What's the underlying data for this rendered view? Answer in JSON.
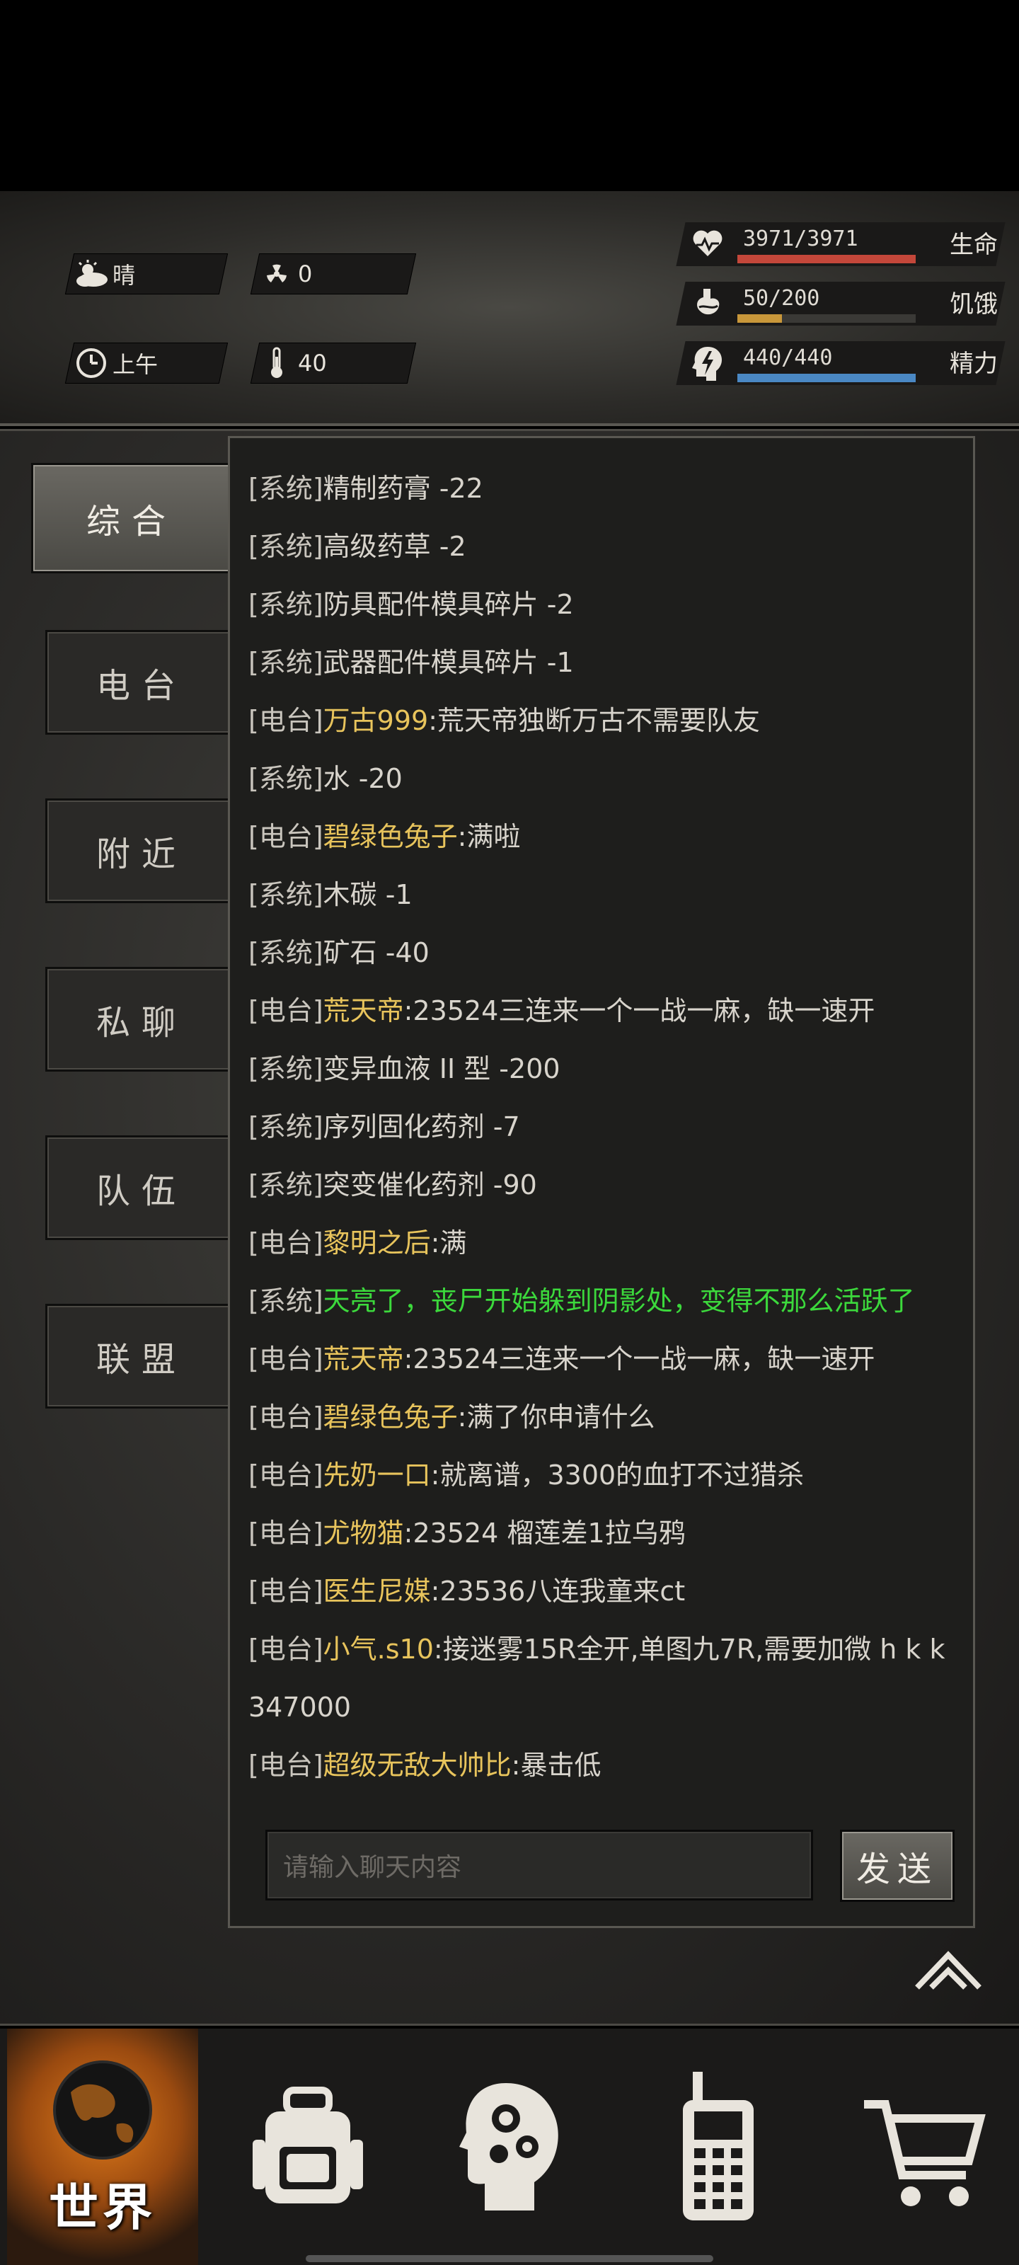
{
  "status": {
    "weather_label": "晴",
    "radiation_value": "0",
    "time_of_day": "上午",
    "temperature_value": "40",
    "vitals": [
      {
        "label": "生命",
        "value": "3971/3971",
        "fill": 1.0,
        "color": "#c4473a",
        "icon": "heart-pulse-icon"
      },
      {
        "label": "饥饿",
        "value": "50/200",
        "fill": 0.25,
        "color": "#c8973a",
        "icon": "stomach-icon"
      },
      {
        "label": "精力",
        "value": "440/440",
        "fill": 1.0,
        "color": "#4a88c4",
        "icon": "head-energy-icon"
      }
    ]
  },
  "tabs": [
    "综合",
    "电台",
    "附近",
    "私聊",
    "队伍",
    "联盟"
  ],
  "active_tab": 0,
  "messages": [
    {
      "tag": "[系统]",
      "nick": "",
      "text": "精制药膏 -22"
    },
    {
      "tag": "[系统]",
      "nick": "",
      "text": "高级药草 -2"
    },
    {
      "tag": "[系统]",
      "nick": "",
      "text": "防具配件模具碎片 -2"
    },
    {
      "tag": "[系统]",
      "nick": "",
      "text": "武器配件模具碎片 -1"
    },
    {
      "tag": "[电台]",
      "nick": "万古999",
      "text": ":荒天帝独断万古不需要队友"
    },
    {
      "tag": "[系统]",
      "nick": "",
      "text": "水 -20"
    },
    {
      "tag": "[电台]",
      "nick": "碧绿色兔子",
      "text": ":满啦"
    },
    {
      "tag": "[系统]",
      "nick": "",
      "text": "木碳 -1"
    },
    {
      "tag": "[系统]",
      "nick": "",
      "text": "矿石 -40"
    },
    {
      "tag": "[电台]",
      "nick": "荒天帝",
      "text": ":23524三连来一个一战一麻，缺一速开"
    },
    {
      "tag": "[系统]",
      "nick": "",
      "text": "变异血液 II 型 -200"
    },
    {
      "tag": "[系统]",
      "nick": "",
      "text": "序列固化药剂 -7"
    },
    {
      "tag": "[系统]",
      "nick": "",
      "text": "突变催化药剂 -90"
    },
    {
      "tag": "[电台]",
      "nick": "黎明之后",
      "text": ":满"
    },
    {
      "tag": "[系统]",
      "nick": "",
      "text": "天亮了，丧尸开始躲到阴影处，变得不那么活跃了",
      "green": true
    },
    {
      "tag": "[电台]",
      "nick": "荒天帝",
      "text": ":23524三连来一个一战一麻，缺一速开"
    },
    {
      "tag": "[电台]",
      "nick": "碧绿色兔子",
      "text": ":满了你申请什么"
    },
    {
      "tag": "[电台]",
      "nick": "先奶一口",
      "text": ":就离谱，3300的血打不过猎杀"
    },
    {
      "tag": "[电台]",
      "nick": "尤物猫",
      "text": ":23524 榴莲差1拉乌鸦"
    },
    {
      "tag": "[电台]",
      "nick": "医生尼媒",
      "text": ":23536八连我童来ct"
    },
    {
      "tag": "[电台]",
      "nick": "小气.s10",
      "text": ":接迷雾15R全开,单图九7R,需要加微 h k k 347000",
      "wrap": true
    },
    {
      "tag": "[电台]",
      "nick": "超级无敌大帅比",
      "text": ":暴击低"
    }
  ],
  "input": {
    "placeholder": "请输入聊天内容"
  },
  "send_label": "发送",
  "nav": {
    "world_label": "世界"
  }
}
